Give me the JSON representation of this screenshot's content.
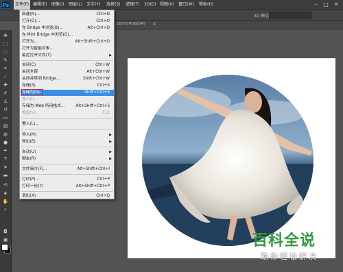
{
  "app": {
    "logo": "Ps"
  },
  "menubar": {
    "items": [
      "文件(F)",
      "编辑(E)",
      "图像(I)",
      "图层(L)",
      "文字(Y)",
      "选择(S)",
      "滤镜(T)",
      "3D(D)",
      "视图(V)",
      "窗口(W)",
      "帮助(H)"
    ],
    "window_controls": [
      "–",
      "□",
      "✕"
    ]
  },
  "options_bar": {
    "mode_label": "3D 模式:"
  },
  "document_tab": {
    "label": "100%(RGB/8#)",
    "close": "×"
  },
  "file_menu": {
    "items": [
      {
        "label": "新建(N)...",
        "shortcut": "Ctrl+N"
      },
      {
        "label": "打开(O)...",
        "shortcut": "Ctrl+O"
      },
      {
        "label": "在 Bridge 中浏览(B)...",
        "shortcut": "Alt+Ctrl+O"
      },
      {
        "label": "在 Mini Bridge 中浏览(G)..."
      },
      {
        "label": "打开为...",
        "shortcut": "Alt+Shift+Ctrl+O"
      },
      {
        "label": "打开为智能对象..."
      },
      {
        "label": "最近打开文件(T)",
        "submenu": true
      },
      {
        "label": "关闭(C)",
        "shortcut": "Ctrl+W"
      },
      {
        "label": "关闭全部",
        "shortcut": "Alt+Ctrl+W"
      },
      {
        "label": "关闭并转到 Bridge...",
        "shortcut": "Shift+Ctrl+W"
      },
      {
        "label": "存储(S)",
        "shortcut": "Ctrl+S"
      },
      {
        "label": "存储为(A)...",
        "shortcut": "Shift+Ctrl+S",
        "selected": true
      },
      {
        "label": "签入(I)...",
        "disabled": true
      },
      {
        "label": "存储为 Web 所用格式...",
        "shortcut": "Alt+Shift+Ctrl+S"
      },
      {
        "label": "恢复(V)",
        "shortcut": "F12",
        "disabled": true
      },
      {
        "label": "置入(L)..."
      },
      {
        "label": "导入(M)",
        "submenu": true
      },
      {
        "label": "导出(E)",
        "submenu": true
      },
      {
        "label": "自动(U)",
        "submenu": true
      },
      {
        "label": "脚本(R)",
        "submenu": true
      },
      {
        "label": "文件简介(F)...",
        "shortcut": "Alt+Shift+Ctrl+I"
      },
      {
        "label": "打印(P)...",
        "shortcut": "Ctrl+P"
      },
      {
        "label": "打印一份(Y)",
        "shortcut": "Alt+Shift+Ctrl+P"
      },
      {
        "label": "退出(X)",
        "shortcut": "Ctrl+Q"
      }
    ]
  },
  "watermark": {
    "title": "百科全说",
    "subtitle": "助你轻松解决"
  },
  "colors": {
    "accent": "#3b8ee6",
    "highlight_border": "#e02020",
    "watermark_green": "#2e9a3a"
  }
}
